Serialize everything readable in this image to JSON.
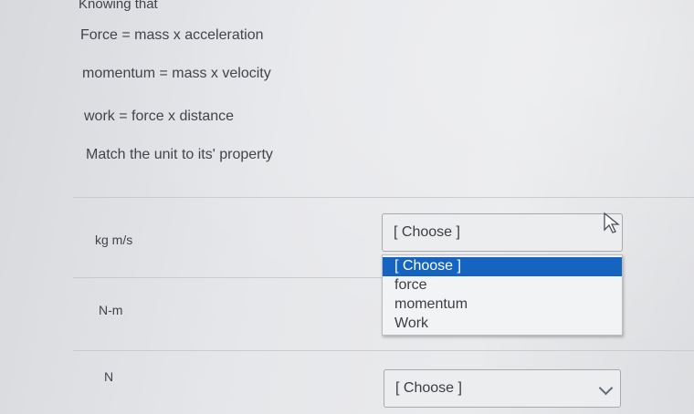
{
  "intro": "Knowing that",
  "formulas": [
    "Force = mass x acceleration",
    "momentum = mass x velocity",
    "work = force x distance"
  ],
  "instruction": "Match the unit to its' property",
  "rows": [
    {
      "unit": "kg m/s",
      "selected": "[ Choose ]"
    },
    {
      "unit": "N-m",
      "selected": ""
    },
    {
      "unit": "N",
      "selected": "[ Choose ]"
    }
  ],
  "dropdown": {
    "options": [
      "[ Choose ]",
      "force",
      "momentum",
      "Work"
    ],
    "highlighted_index": 0,
    "highlight_color": "#1565c0"
  }
}
